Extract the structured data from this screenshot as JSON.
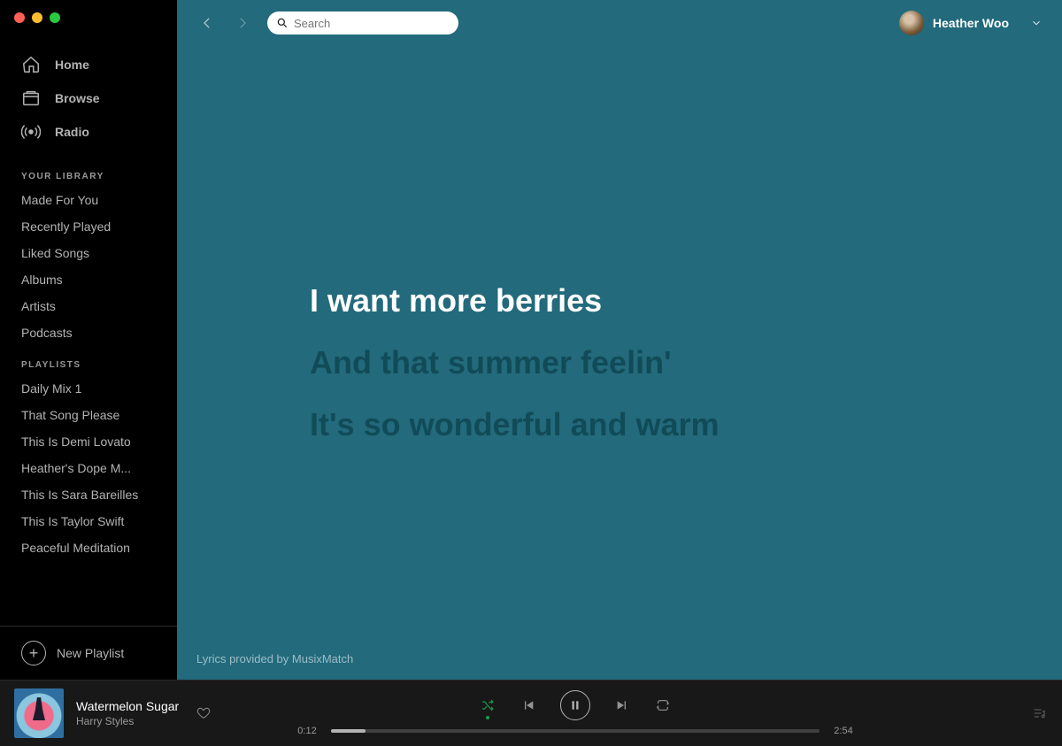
{
  "window": {
    "traffic_colors": {
      "close": "#ff5f57",
      "min": "#febc2e",
      "max": "#28c840"
    }
  },
  "sidebar": {
    "nav": [
      {
        "label": "Home",
        "icon": "home-icon"
      },
      {
        "label": "Browse",
        "icon": "browse-icon"
      },
      {
        "label": "Radio",
        "icon": "radio-icon"
      }
    ],
    "library_header": "YOUR LIBRARY",
    "library": [
      "Made For You",
      "Recently Played",
      "Liked Songs",
      "Albums",
      "Artists",
      "Podcasts"
    ],
    "playlists_header": "PLAYLISTS",
    "playlists": [
      "Daily Mix 1",
      "That Song Please",
      "This Is Demi Lovato",
      "Heather's Dope M...",
      "This Is Sara Bareilles",
      "This Is Taylor Swift",
      "Peaceful Meditation"
    ],
    "new_playlist_label": "New Playlist"
  },
  "topbar": {
    "search_placeholder": "Search",
    "user_name": "Heather Woo"
  },
  "lyrics": {
    "lines": [
      {
        "text": "I want more berries",
        "active": true
      },
      {
        "text": "And that summer feelin'",
        "active": false
      },
      {
        "text": "It's so wonderful and warm",
        "active": false
      }
    ],
    "credit": "Lyrics provided by MusixMatch",
    "bg_color": "#226a7c"
  },
  "player": {
    "track_title": "Watermelon Sugar",
    "track_artist": "Harry Styles",
    "elapsed": "0:12",
    "duration": "2:54",
    "shuffle_on": true,
    "playing": true
  }
}
